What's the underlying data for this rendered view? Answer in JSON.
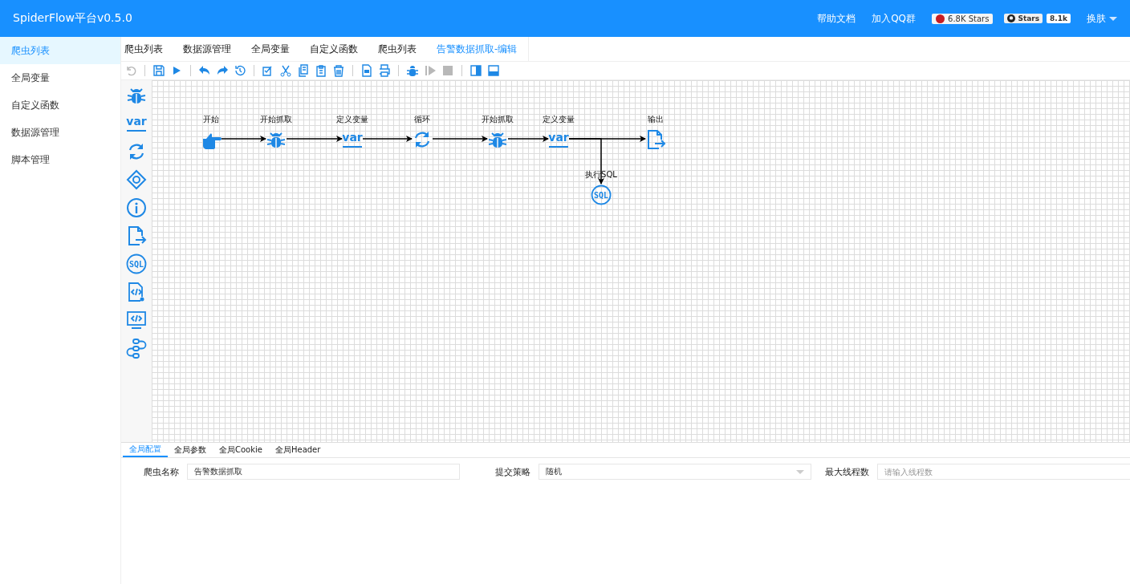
{
  "header": {
    "title": "SpiderFlow平台v0.5.0",
    "links": [
      "帮助文档",
      "加入QQ群"
    ],
    "gitee_badge": "6.8K Stars",
    "github_badge": {
      "label": "Stars",
      "count": "8.1k"
    },
    "skin_menu": "换肤"
  },
  "sidebar": {
    "items": [
      {
        "label": "爬虫列表",
        "selected": true
      },
      {
        "label": "全局变量",
        "selected": false
      },
      {
        "label": "自定义函数",
        "selected": false
      },
      {
        "label": "数据源管理",
        "selected": false
      },
      {
        "label": "脚本管理",
        "selected": false
      }
    ]
  },
  "tabs": [
    {
      "label": "爬虫列表",
      "selected": false
    },
    {
      "label": "数据源管理",
      "selected": false
    },
    {
      "label": "全局变量",
      "selected": false
    },
    {
      "label": "自定义函数",
      "selected": false
    },
    {
      "label": "爬虫列表",
      "selected": false
    },
    {
      "label": "告警数据抓取-编辑",
      "selected": true
    }
  ],
  "toolbar": [
    {
      "kind": "revert",
      "disabled": true
    },
    {
      "kind": "separator"
    },
    {
      "kind": "save",
      "disabled": false
    },
    {
      "kind": "run",
      "disabled": false
    },
    {
      "kind": "separator"
    },
    {
      "kind": "undo",
      "disabled": false
    },
    {
      "kind": "redo",
      "disabled": false
    },
    {
      "kind": "history",
      "disabled": false
    },
    {
      "kind": "separator"
    },
    {
      "kind": "select-all",
      "disabled": false
    },
    {
      "kind": "cut",
      "disabled": false
    },
    {
      "kind": "copy",
      "disabled": false
    },
    {
      "kind": "paste",
      "disabled": false
    },
    {
      "kind": "delete",
      "disabled": false
    },
    {
      "kind": "separator"
    },
    {
      "kind": "export",
      "disabled": false
    },
    {
      "kind": "print",
      "disabled": false
    },
    {
      "kind": "separator"
    },
    {
      "kind": "debug",
      "disabled": false
    },
    {
      "kind": "step",
      "disabled": true
    },
    {
      "kind": "stop",
      "disabled": true
    },
    {
      "kind": "separator"
    },
    {
      "kind": "panel-right",
      "disabled": false
    },
    {
      "kind": "panel-bottom",
      "disabled": false
    }
  ],
  "palette": [
    {
      "kind": "spider"
    },
    {
      "kind": "variable",
      "icon_text": "var"
    },
    {
      "kind": "loop"
    },
    {
      "kind": "condition"
    },
    {
      "kind": "info"
    },
    {
      "kind": "output"
    },
    {
      "kind": "sql",
      "icon_text": "SQL"
    },
    {
      "kind": "code-file"
    },
    {
      "kind": "monitor-code"
    },
    {
      "kind": "process"
    }
  ],
  "flow": {
    "nodes": [
      {
        "kind": "start",
        "label": "开始"
      },
      {
        "kind": "spider",
        "label": "开始抓取"
      },
      {
        "kind": "variable",
        "label": "定义变量",
        "icon_text": "var"
      },
      {
        "kind": "loop",
        "label": "循环"
      },
      {
        "kind": "spider",
        "label": "开始抓取"
      },
      {
        "kind": "variable",
        "label": "定义变量",
        "icon_text": "var"
      },
      {
        "kind": "sql",
        "label": "执行SQL",
        "icon_text": "SQL",
        "branch": true
      },
      {
        "kind": "output",
        "label": "输出"
      }
    ]
  },
  "bottom_tabs": [
    {
      "label": "全局配置",
      "selected": true
    },
    {
      "label": "全局参数",
      "selected": false
    },
    {
      "label": "全局Cookie",
      "selected": false
    },
    {
      "label": "全局Header",
      "selected": false
    }
  ],
  "form": {
    "fields": [
      {
        "kind": "text",
        "label": "爬虫名称",
        "value": "告警数据抓取"
      },
      {
        "kind": "select",
        "label": "提交策略",
        "value": "随机"
      },
      {
        "kind": "text",
        "label": "最大线程数",
        "placeholder": "请输入线程数"
      }
    ]
  }
}
